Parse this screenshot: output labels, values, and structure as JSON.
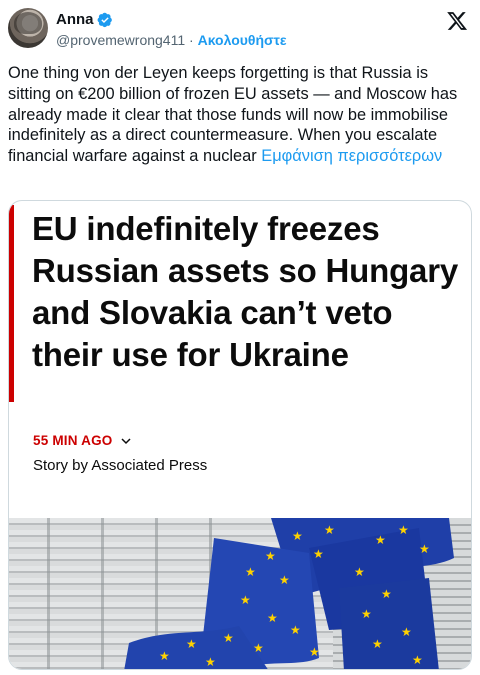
{
  "tweet": {
    "author_name": "Anna",
    "handle": "@provemewrong411",
    "separator": "·",
    "follow_label": "Ακολουθήστε",
    "text": "One  thing von der Leyen keeps forgetting is that Russia is sitting on €200 billion of frozen EU assets — and Moscow has already made it clear that those funds will now be immobilise indefinitely as a direct countermeasure. When you escalate financial warfare against a nuclear ",
    "show_more_label": "Εμφάνιση περισσότερων"
  },
  "card": {
    "headline": "EU indefinitely freezes Russian assets so Hungary and Slovakia can’t veto their use for Ukraine",
    "time_ago": "55 MIN AGO",
    "byline": "Story by Associated Press"
  },
  "colors": {
    "accent_blue": "#1d9bf0",
    "news_red": "#cc0000",
    "flag_blue": "#1f3fa8",
    "star_yellow": "#ffd200"
  },
  "icons": {
    "verified": "verified-badge-icon",
    "platform": "x-logo-icon",
    "expand": "chevron-down-icon"
  }
}
